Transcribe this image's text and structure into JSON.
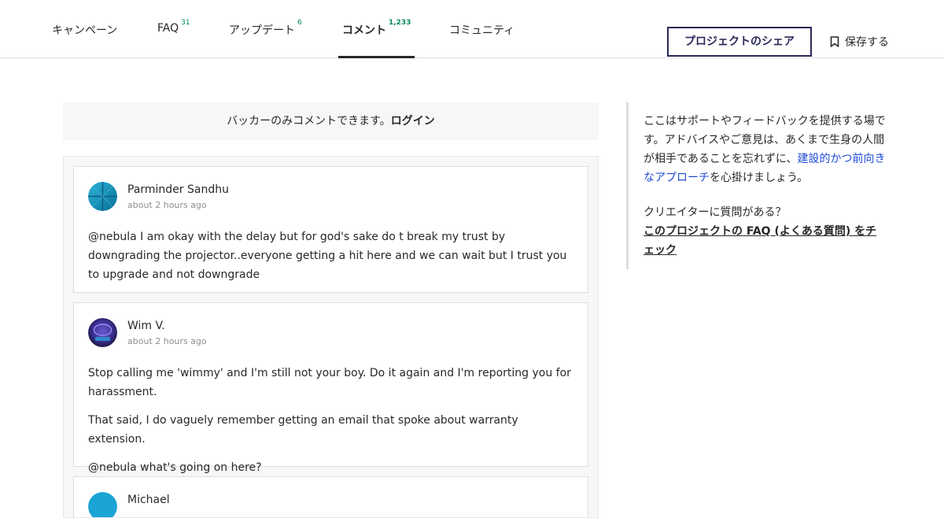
{
  "nav": {
    "tabs": [
      {
        "label": "キャンペーン",
        "count": ""
      },
      {
        "label": "FAQ",
        "count": "31"
      },
      {
        "label": "アップデート",
        "count": "6"
      },
      {
        "label": "コメント",
        "count": "1,233"
      },
      {
        "label": "コミュニティ",
        "count": ""
      }
    ],
    "share_label": "プロジェクトのシェア",
    "save_label": "保存する"
  },
  "login_banner": {
    "text": "バッカーのみコメントできます。",
    "link": "ログイン"
  },
  "comments": [
    {
      "author": "Parminder Sandhu",
      "time": "about 2 hours ago",
      "paragraphs": [
        "@nebula I am okay with the delay but for god's sake do t break my trust by downgrading the projector..everyone getting a hit here and we can wait but I trust you to upgrade and not downgrade"
      ]
    },
    {
      "author": "Wim V.",
      "time": "about 2 hours ago",
      "paragraphs": [
        "Stop calling me 'wimmy' and I'm still not your boy. Do it again and I'm reporting you for harassment.",
        "That said, I do vaguely remember getting an email that spoke about warranty extension.",
        "@nebula what's going on here?"
      ]
    },
    {
      "author": "Michael",
      "time": "",
      "paragraphs": []
    }
  ],
  "sidebar": {
    "intro_before": "ここはサポートやフィードバックを提供する場です。アドバイスやご意見は、あくまで生身の人間が相手であることを忘れずに、",
    "intro_link": "建設的かつ前向きなアプローチ",
    "intro_after": "を心掛けましょう。",
    "question": "クリエイターに質問がある？",
    "faq_link": "このプロジェクトの FAQ (よくある質問) をチェック"
  },
  "colors": {
    "count_green": "#028858",
    "link_blue": "#1f4bd6",
    "share_border": "#282856"
  }
}
